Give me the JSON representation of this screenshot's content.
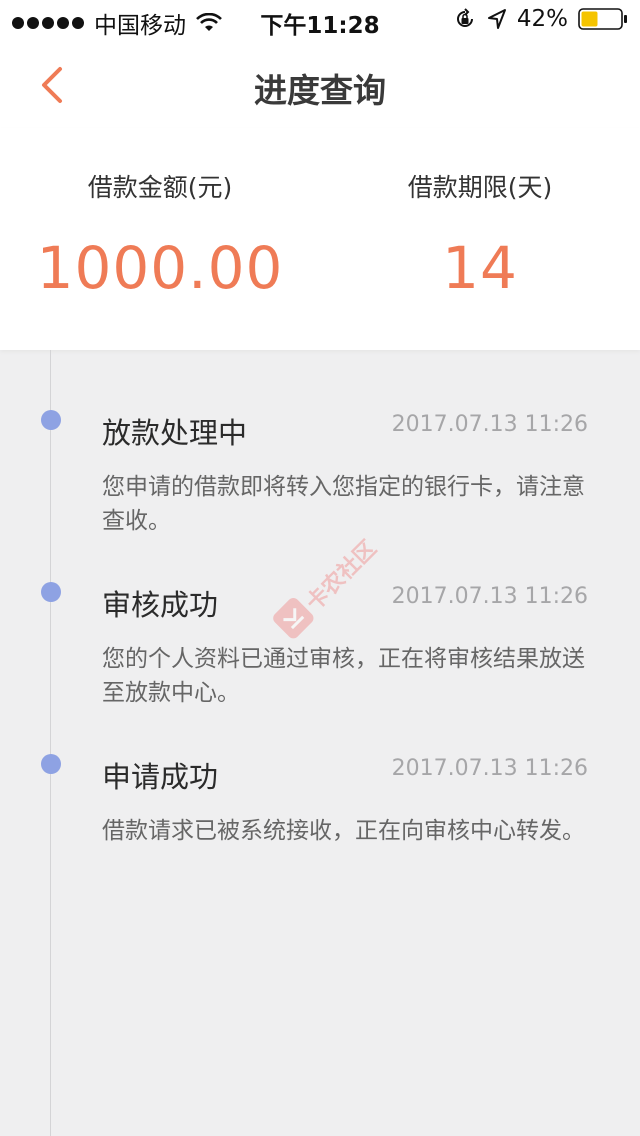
{
  "status_bar": {
    "carrier": "中国移动",
    "time": "下午11:28",
    "battery_percent": "42%",
    "battery_level": 0.42,
    "icons": [
      "signal-dots-icon",
      "wifi-icon",
      "rotation-lock-icon",
      "location-arrow-icon",
      "battery-icon"
    ]
  },
  "nav": {
    "title": "进度查询",
    "back_icon": "chevron-left-icon"
  },
  "summary": {
    "amount_label": "借款金额(元)",
    "amount_value": "1000.00",
    "term_label": "借款期限(天)",
    "term_value": "14"
  },
  "timeline": [
    {
      "title": "放款处理中",
      "time": "2017.07.13 11:26",
      "description": "您申请的借款即将转入您指定的银行卡，请注意查收。"
    },
    {
      "title": "审核成功",
      "time": "2017.07.13 11:26",
      "description": "您的个人资料已通过审核，正在将审核结果放送至放款中心。"
    },
    {
      "title": "申请成功",
      "time": "2017.07.13 11:26",
      "description": "借款请求已被系统接收，正在向审核中心转发。"
    }
  ],
  "watermark": {
    "text": "卡农社区"
  },
  "colors": {
    "accent": "#ef7b56",
    "timeline_dot": "#8ea2e3",
    "background": "#efeff0",
    "battery_fill": "#f5c400"
  }
}
